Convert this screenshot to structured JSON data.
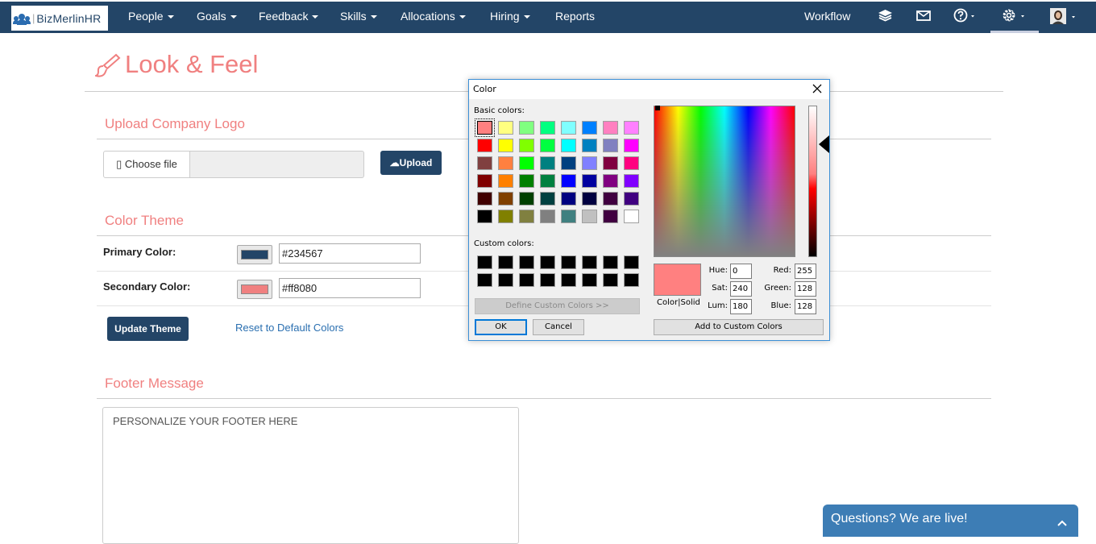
{
  "nav": {
    "logo_text": "BizMerlinHR",
    "items": [
      {
        "label": "People",
        "dropdown": true
      },
      {
        "label": "Goals",
        "dropdown": true
      },
      {
        "label": "Feedback",
        "dropdown": true
      },
      {
        "label": "Skills",
        "dropdown": true
      },
      {
        "label": "Allocations",
        "dropdown": true
      },
      {
        "label": "Hiring",
        "dropdown": true
      },
      {
        "label": "Reports",
        "dropdown": false
      }
    ],
    "workflow_label": "Workflow",
    "icons": [
      "layers-icon",
      "mail-icon",
      "help-icon",
      "gear-icon",
      "avatar"
    ]
  },
  "page": {
    "title": "Look & Feel",
    "title_icon": "paint-brush-icon"
  },
  "logo_section": {
    "title": "Upload Company Logo",
    "choose_label": "Choose file",
    "file_name": "",
    "upload_label": "Upload"
  },
  "theme_section": {
    "title": "Color Theme",
    "primary_label": "Primary Color:",
    "primary_value": "#234567",
    "primary_swatch": "#234567",
    "secondary_label": "Secondary Color:",
    "secondary_value": "#ff8080",
    "secondary_swatch": "#f08080",
    "update_label": "Update Theme",
    "reset_label": "Reset to Default Colors"
  },
  "footer_section": {
    "title": "Footer Message",
    "placeholder": "PERSONALIZE YOUR FOOTER HERE"
  },
  "color_dialog": {
    "title": "Color",
    "basic_colors_label": "Basic colors:",
    "custom_colors_label": "Custom colors:",
    "define_custom_label": "Define Custom Colors >>",
    "ok_label": "OK",
    "cancel_label": "Cancel",
    "add_custom_label": "Add to Custom Colors",
    "color_solid_label": "Color|Solid",
    "hue_label": "Hue:",
    "hue": "0",
    "sat_label": "Sat:",
    "sat": "240",
    "lum_label": "Lum:",
    "lum": "180",
    "red_label": "Red:",
    "red": "255",
    "green_label": "Green:",
    "green": "128",
    "blue_label": "Blue:",
    "blue": "128",
    "preview_color": "#ff8080",
    "basic_colors": [
      "#ff8080",
      "#ffff80",
      "#80ff80",
      "#00ff80",
      "#80ffff",
      "#0080ff",
      "#ff80c0",
      "#ff80ff",
      "#ff0000",
      "#ffff00",
      "#80ff00",
      "#00ff40",
      "#00ffff",
      "#0080c0",
      "#8080c0",
      "#ff00ff",
      "#804040",
      "#ff8040",
      "#00ff00",
      "#008080",
      "#004080",
      "#8080ff",
      "#800040",
      "#ff0080",
      "#800000",
      "#ff8000",
      "#008000",
      "#008040",
      "#0000ff",
      "#0000a0",
      "#800080",
      "#8000ff",
      "#400000",
      "#804000",
      "#004000",
      "#004040",
      "#000080",
      "#000040",
      "#400040",
      "#400080",
      "#000000",
      "#808000",
      "#808040",
      "#808080",
      "#408080",
      "#c0c0c0",
      "#400040",
      "#ffffff"
    ],
    "custom_colors": [
      "#000000",
      "#000000",
      "#000000",
      "#000000",
      "#000000",
      "#000000",
      "#000000",
      "#000000",
      "#000000",
      "#000000",
      "#000000",
      "#000000",
      "#000000",
      "#000000",
      "#000000",
      "#000000"
    ]
  },
  "chat": {
    "label": "Questions? We are live!"
  }
}
